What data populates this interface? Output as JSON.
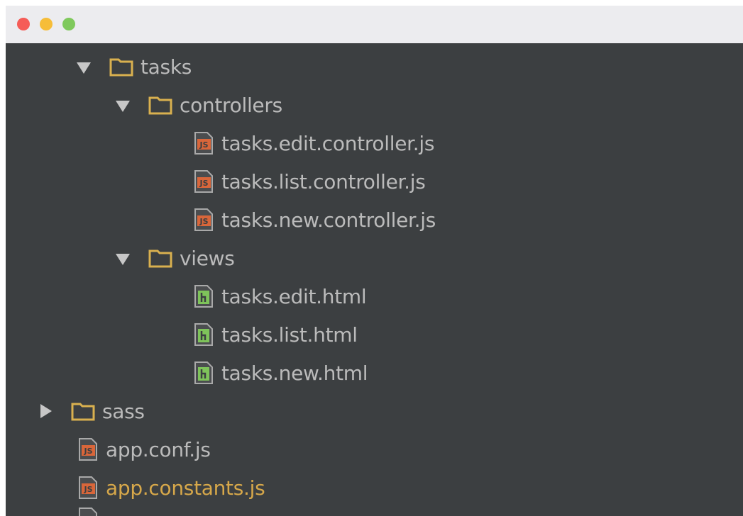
{
  "window": {
    "traffic_lights": [
      "close",
      "minimize",
      "zoom"
    ]
  },
  "tree": {
    "items": [
      {
        "label": "tasks",
        "type": "folder",
        "expanded": true,
        "depth": 2
      },
      {
        "label": "controllers",
        "type": "folder",
        "expanded": true,
        "depth": 3
      },
      {
        "label": "tasks.edit.controller.js",
        "type": "js-file",
        "depth": 4
      },
      {
        "label": "tasks.list.controller.js",
        "type": "js-file",
        "depth": 4
      },
      {
        "label": "tasks.new.controller.js",
        "type": "js-file",
        "depth": 4
      },
      {
        "label": "views",
        "type": "folder",
        "expanded": true,
        "depth": 3
      },
      {
        "label": "tasks.edit.html",
        "type": "html-file",
        "depth": 4
      },
      {
        "label": "tasks.list.html",
        "type": "html-file",
        "depth": 4
      },
      {
        "label": "tasks.new.html",
        "type": "html-file",
        "depth": 4
      },
      {
        "label": "sass",
        "type": "folder",
        "expanded": false,
        "depth": 1
      },
      {
        "label": "app.conf.js",
        "type": "js-file",
        "depth": 1
      },
      {
        "label": "app.constants.js",
        "type": "js-file",
        "depth": 1,
        "status": "modified"
      }
    ]
  },
  "colors": {
    "panel_background": "#3c3f41",
    "titlebar_background": "#ececef",
    "text": "#bbbbbb",
    "modified_text": "#d7a84a",
    "folder_icon": "#d9b04f",
    "js_icon": "#d9663a",
    "html_icon": "#7ec35a"
  }
}
